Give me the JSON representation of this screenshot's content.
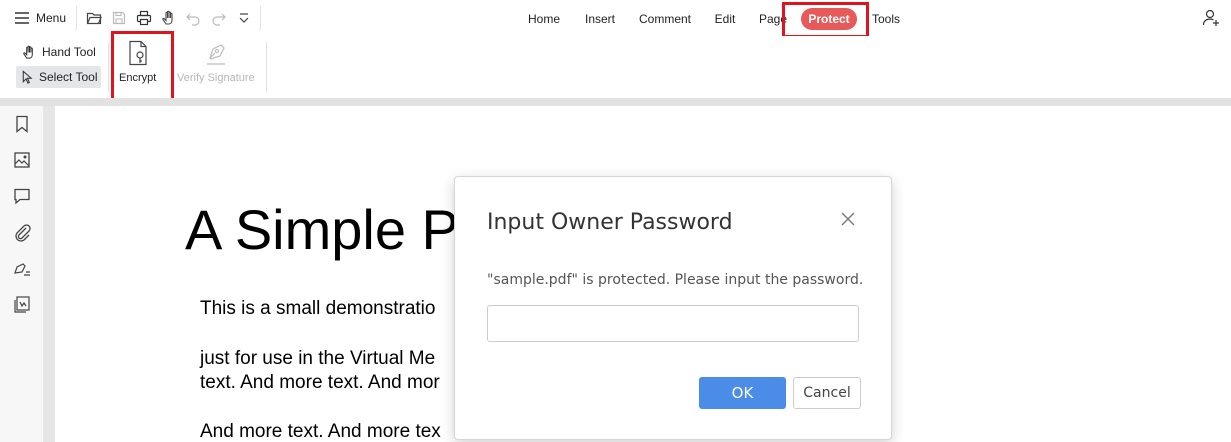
{
  "topbar": {
    "menu_label": "Menu",
    "quick_access": [
      "open-folder-icon",
      "save-icon",
      "print-icon",
      "hand-icon",
      "undo-icon",
      "redo-icon",
      "dropdown-icon"
    ],
    "nav_tabs": [
      "Home",
      "Insert",
      "Comment",
      "Edit",
      "Page",
      "Protect",
      "Tools"
    ],
    "active_tab": "Protect"
  },
  "ribbon": {
    "hand_tool": "Hand Tool",
    "select_tool": "Select Tool",
    "encrypt": "Encrypt",
    "verify_signature": "Verify Signature"
  },
  "sidebar": {
    "icons": [
      "bookmark-icon",
      "thumbnail-icon",
      "comment-icon",
      "attachment-icon",
      "signature-icon",
      "stamp-icon"
    ]
  },
  "document": {
    "title": "A Simple P",
    "lines": [
      "This is a small demonstratio",
      "just for use in the Virtual Me",
      "text. And more text. And mor",
      "And more text. And more tex"
    ]
  },
  "dialog": {
    "title": "Input Owner Password",
    "message": "\"sample.pdf\" is protected. Please input the password.",
    "password_value": "",
    "ok_label": "OK",
    "cancel_label": "Cancel"
  },
  "colors": {
    "active_tab_bg": "#e85a5a",
    "highlight": "#e0141e",
    "ok_button": "#4a8ce8"
  }
}
